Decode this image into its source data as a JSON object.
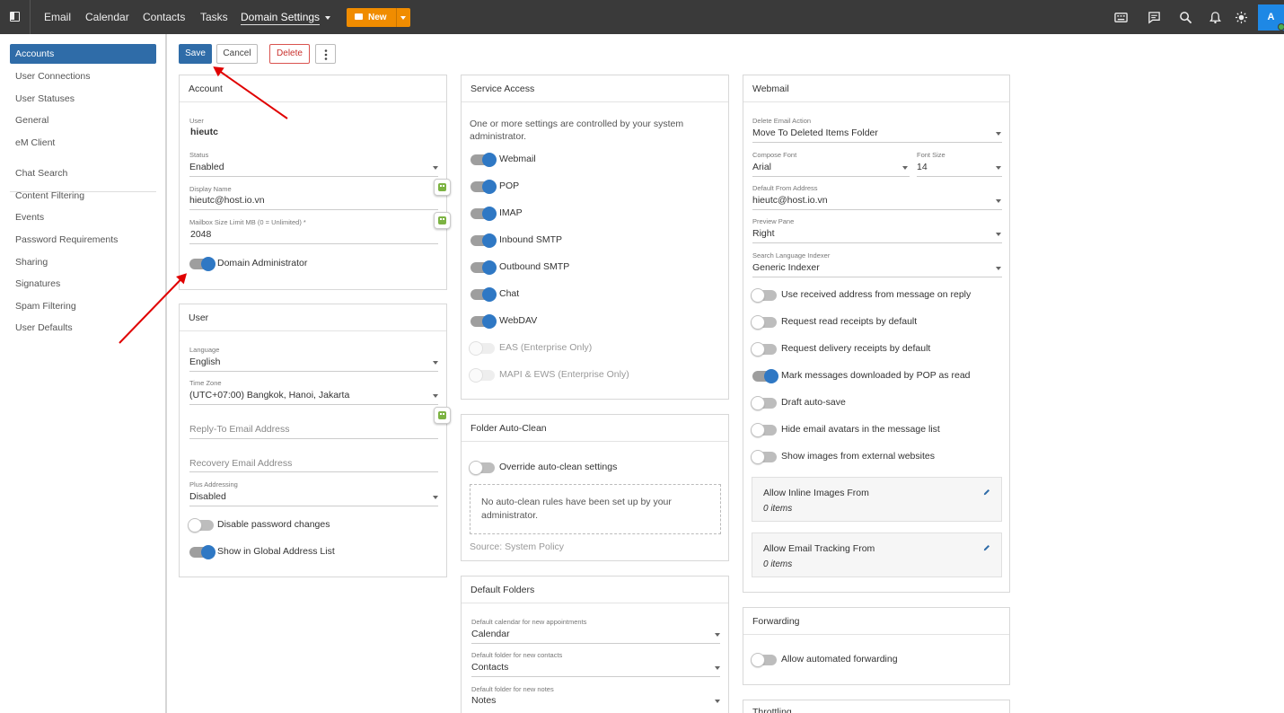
{
  "topbar": {
    "nav": [
      "Email",
      "Calendar",
      "Contacts",
      "Tasks",
      "Domain Settings"
    ],
    "new_label": "New",
    "avatar_initial": "A"
  },
  "toolbar": {
    "save": "Save",
    "cancel": "Cancel",
    "delete": "Delete"
  },
  "sidebar": {
    "items": [
      "Accounts",
      "User Connections",
      "User Statuses",
      "General",
      "eM Client",
      "Chat Search",
      "Content Filtering",
      "Events",
      "Password Requirements",
      "Sharing",
      "Signatures",
      "Spam Filtering",
      "User Defaults"
    ]
  },
  "account": {
    "title": "Account",
    "user_label": "User",
    "user_value": "hieutc",
    "status_label": "Status",
    "status_value": "Enabled",
    "display_label": "Display Name",
    "display_value": "hieutc@host.io.vn",
    "mailbox_label": "Mailbox Size Limit MB (0 = Unlimited) *",
    "mailbox_value": "2048",
    "domain_admin": "Domain Administrator"
  },
  "user": {
    "title": "User",
    "language_label": "Language",
    "language_value": "English",
    "tz_label": "Time Zone",
    "tz_value": "(UTC+07:00) Bangkok, Hanoi, Jakarta",
    "reply_to": "Reply-To Email Address",
    "recovery": "Recovery Email Address",
    "plus_label": "Plus Addressing",
    "plus_value": "Disabled",
    "disable_pw": "Disable password changes",
    "show_gal": "Show in Global Address List"
  },
  "service": {
    "title": "Service Access",
    "notice": [
      "One or more settings are controlled by your system",
      "administrator."
    ],
    "items": [
      "Webmail",
      "POP",
      "IMAP",
      "Inbound SMTP",
      "Outbound SMTP",
      "Chat",
      "WebDAV",
      "EAS (Enterprise Only)",
      "MAPI & EWS (Enterprise Only)"
    ]
  },
  "autoclean": {
    "title": "Folder Auto-Clean",
    "override": "Override auto-clean settings",
    "empty": [
      "No auto-clean rules have been set up by your",
      "administrator."
    ],
    "source": "Source: System Policy"
  },
  "folders": {
    "title": "Default Folders",
    "cal_label": "Default calendar for new appointments",
    "cal_value": "Calendar",
    "con_label": "Default folder for new contacts",
    "con_value": "Contacts",
    "notes_label": "Default folder for new notes",
    "notes_value": "Notes"
  },
  "webmail": {
    "title": "Webmail",
    "delete_label": "Delete Email Action",
    "delete_value": "Move To Deleted Items Folder",
    "font_label": "Compose Font",
    "font_value": "Arial",
    "size_label": "Font Size",
    "size_value": "14",
    "from_label": "Default From Address",
    "from_value": "hieutc@host.io.vn",
    "preview_label": "Preview Pane",
    "preview_value": "Right",
    "indexer_label": "Search Language Indexer",
    "indexer_value": "Generic Indexer",
    "toggles": [
      "Use received address from message on reply",
      "Request read receipts by default",
      "Request delivery receipts by default",
      "Mark messages downloaded by POP as read",
      "Draft auto-save",
      "Hide email avatars in the message list",
      "Show images from external websites"
    ],
    "inline_title": "Allow Inline Images From",
    "inline_count": "0 items",
    "tracking_title": "Allow Email Tracking From",
    "tracking_count": "0 items"
  },
  "forwarding": {
    "title": "Forwarding",
    "auto": "Allow automated forwarding"
  },
  "throttling": {
    "title": "Throttling"
  }
}
